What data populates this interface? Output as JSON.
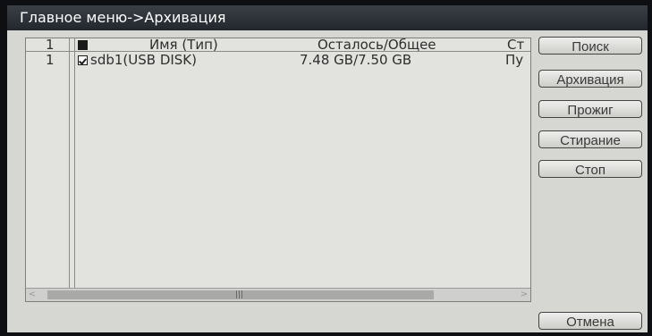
{
  "window": {
    "title": "Главное меню->Архивация"
  },
  "table": {
    "columns": [
      "1",
      "Имя (Тип)",
      "Осталось/Общее",
      "Ст"
    ],
    "rows": [
      {
        "index": "1",
        "name": "sdb1(USB DISK)",
        "space": "7.48 GB/7.50 GB",
        "status": "Пу"
      }
    ]
  },
  "buttons": {
    "search": "Поиск",
    "archive": "Архивация",
    "burn": "Прожиг",
    "erase": "Стирание",
    "stop": "Стоп",
    "cancel": "Отмена"
  },
  "scrollbar": {
    "left_arrow": "<",
    "right_arrow": ">",
    "grip": "|||"
  },
  "colors": {
    "background": "#0d0f13",
    "panel": "#d6d6d3",
    "title_text": "#ffffff"
  }
}
